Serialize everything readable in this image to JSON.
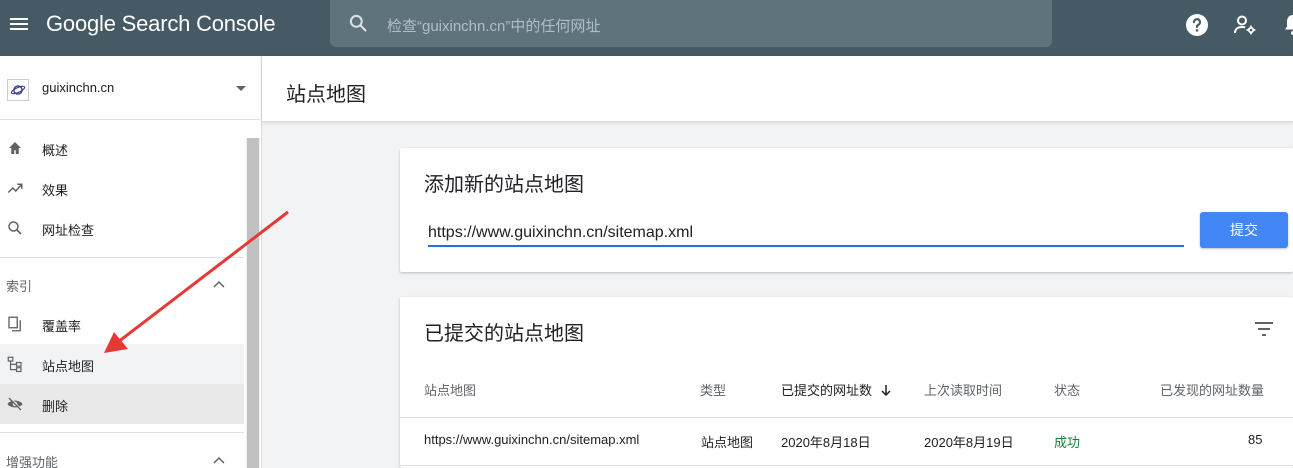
{
  "header": {
    "app_title": "Google Search Console",
    "search_placeholder": "检查“guixinchn.cn”中的任何网址"
  },
  "sidebar": {
    "property": "guixinchn.cn",
    "items_top": [
      {
        "label": "概述",
        "icon": "home-icon"
      },
      {
        "label": "效果",
        "icon": "trending-up-icon"
      },
      {
        "label": "网址检查",
        "icon": "search-icon"
      }
    ],
    "section_index": "索引",
    "items_index": [
      {
        "label": "覆盖率",
        "icon": "copy-pages-icon"
      },
      {
        "label": "站点地图",
        "icon": "sitemap-icon"
      },
      {
        "label": "删除",
        "icon": "eye-off-icon"
      }
    ],
    "section_enhancements": "增强功能"
  },
  "main": {
    "page_title": "站点地图",
    "add_card": {
      "title": "添加新的站点地图",
      "input_value": "https://www.guixinchn.cn/sitemap.xml",
      "submit_label": "提交"
    },
    "list_card": {
      "title": "已提交的站点地图",
      "columns": [
        "站点地图",
        "类型",
        "已提交的网址数",
        "上次读取时间",
        "状态",
        "已发现的网址数量"
      ],
      "rows": [
        [
          "https://www.guixinchn.cn/sitemap.xml",
          "站点地图",
          "2020年8月18日",
          "2020年8月19日",
          "成功",
          "85"
        ]
      ]
    }
  },
  "colors": {
    "header_bg": "#455a64",
    "accent": "#4285f4",
    "success": "#188038",
    "annotation_arrow": "#e53935"
  }
}
